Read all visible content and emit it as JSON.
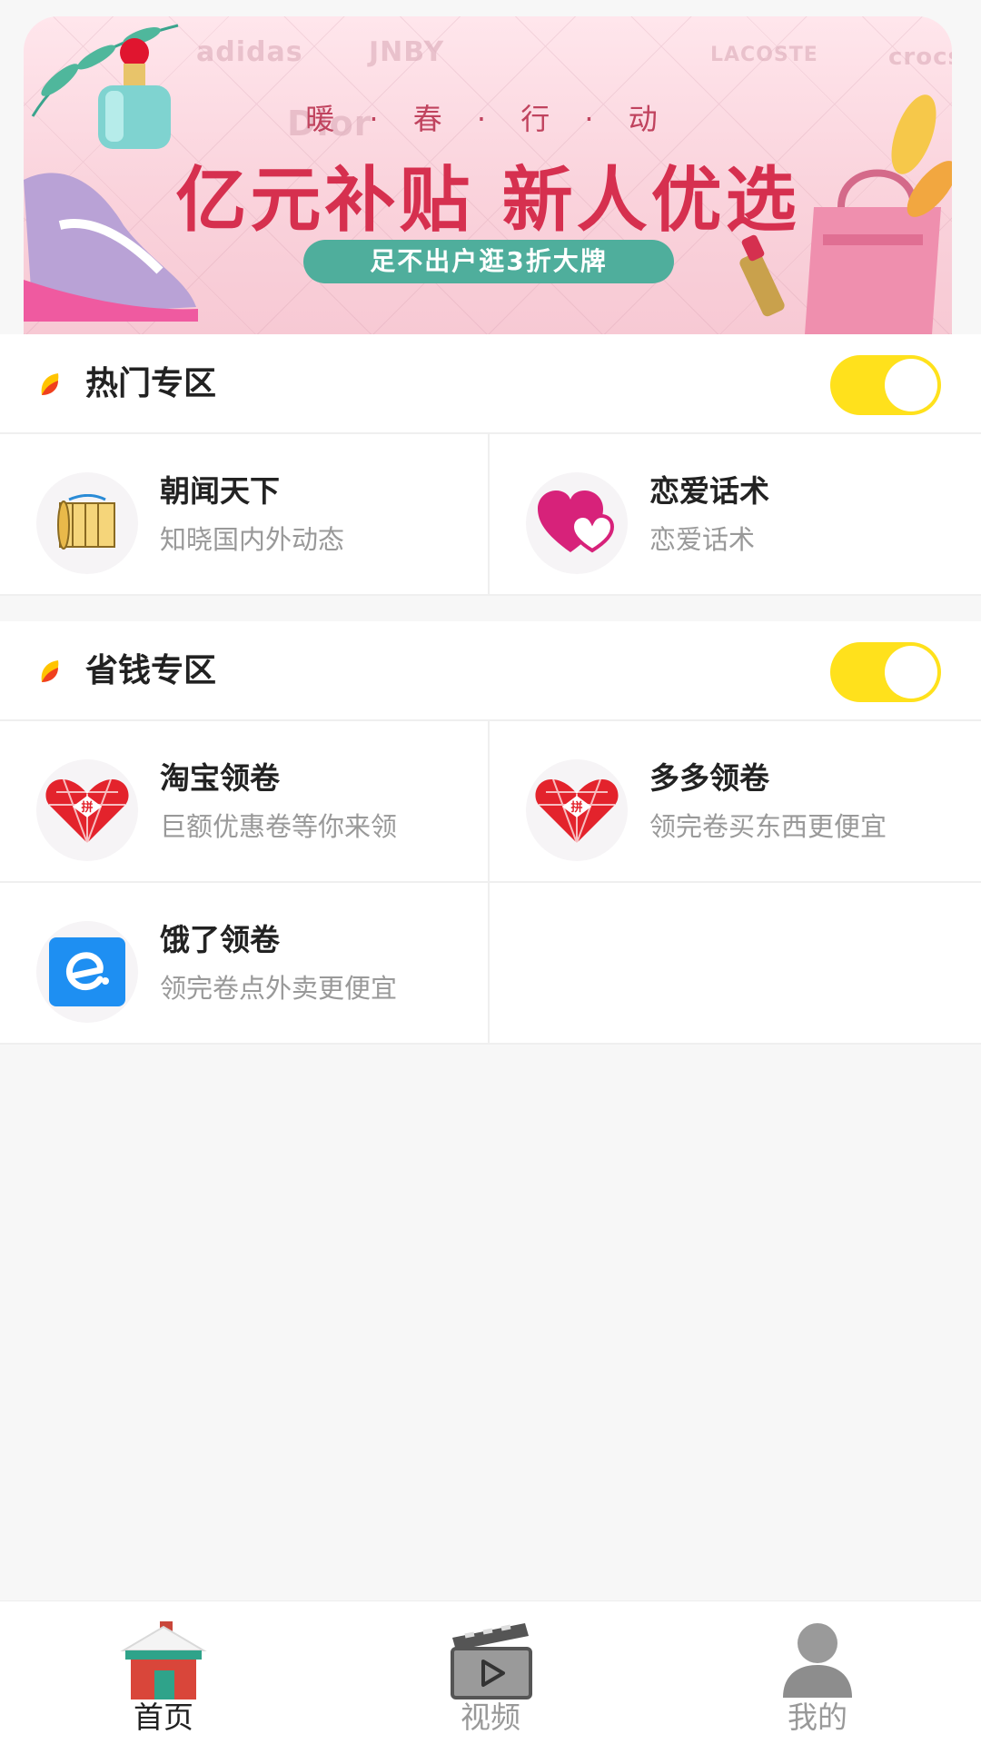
{
  "banner": {
    "subtitle": "暖 · 春 · 行 · 动",
    "title": "亿元补贴 新人优选",
    "pill": "足不出户逛3折大牌",
    "brands": [
      "adidas",
      "JNBY",
      "LACOSTE",
      "crocs",
      "Dior"
    ]
  },
  "sections": [
    {
      "title": "热门专区",
      "toggle_on": true,
      "items": [
        {
          "title": "朝闻天下",
          "desc": "知晓国内外动态",
          "icon": "scroll-icon"
        },
        {
          "title": "恋爱话术",
          "desc": "恋爱话术",
          "icon": "hearts-icon"
        }
      ]
    },
    {
      "title": "省钱专区",
      "toggle_on": true,
      "items": [
        {
          "title": "淘宝领卷",
          "desc": "巨额优惠卷等你来领",
          "icon": "pinduoduo-heart-icon"
        },
        {
          "title": "多多领卷",
          "desc": "领完卷买东西更便宜",
          "icon": "pinduoduo-heart-icon"
        },
        {
          "title": "饿了领卷",
          "desc": "领完卷点外卖更便宜",
          "icon": "eleme-icon"
        }
      ]
    }
  ],
  "tabs": [
    {
      "label": "首页",
      "icon": "house-icon",
      "active": true
    },
    {
      "label": "视频",
      "icon": "clapperboard-icon",
      "active": false
    },
    {
      "label": "我的",
      "icon": "user-icon",
      "active": false
    }
  ],
  "colors": {
    "accent": "#ffe11c",
    "banner_title": "#d6304f",
    "pill": "#4fae9c",
    "background": "#f7f7f7"
  }
}
